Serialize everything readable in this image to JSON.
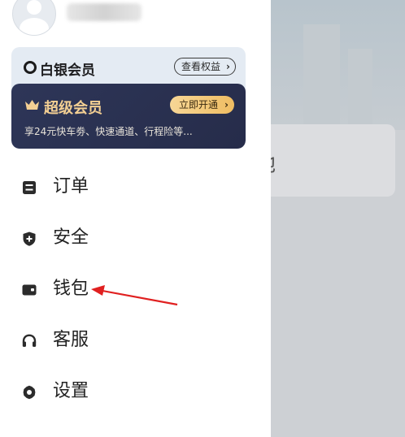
{
  "background": {
    "card_text": "地"
  },
  "drawer": {
    "membership": {
      "silver_title": "白银会员",
      "benefits_button": "查看权益",
      "super_title": "超级会员",
      "open_button": "立即开通",
      "super_desc": "享24元快车劵、快速通道、行程险等..."
    },
    "menu": [
      {
        "label": "订单",
        "icon": "order-icon"
      },
      {
        "label": "安全",
        "icon": "shield-icon"
      },
      {
        "label": "钱包",
        "icon": "wallet-icon"
      },
      {
        "label": "客服",
        "icon": "headset-icon"
      },
      {
        "label": "设置",
        "icon": "gear-icon"
      }
    ]
  },
  "colors": {
    "gold": "#f3cf93",
    "navy": "#2a3150",
    "annotation_red": "#e02020"
  }
}
